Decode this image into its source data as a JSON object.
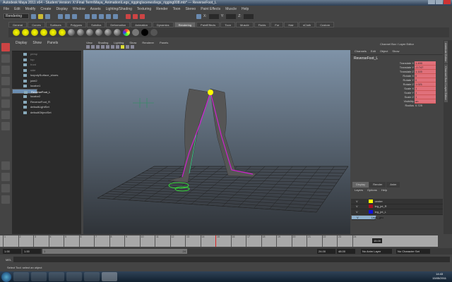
{
  "title": "Autodesk Maya 2011 x64 - Student Version: X:\\Final Term\\Maya_Animation\\Legs_rigging\\scenes\\legs_rigging008.mb* --- ReverseFoot_L",
  "menu": [
    "File",
    "Edit",
    "Modify",
    "Create",
    "Display",
    "Window",
    "Assets",
    "Lighting/Shading",
    "Texturing",
    "Render",
    "Toon",
    "Stereo",
    "Paint Effects",
    "Muscle",
    "Help"
  ],
  "menu_set": "Rendering",
  "coords": {
    "x": "X:",
    "y": "Y:",
    "z": "Z:"
  },
  "shelf_tabs": [
    "General",
    "Curves",
    "Surfaces",
    "Polygons",
    "Subdivs",
    "Deformation",
    "Animation",
    "Dynamics",
    "Rendering",
    "PaintEffects",
    "Toon",
    "Muscle",
    "Fluids",
    "Fur",
    "Hair",
    "nCloth",
    "Custom"
  ],
  "active_shelf": "Rendering",
  "outliner": {
    "menu": [
      "Display",
      "Show",
      "Panels"
    ],
    "items": [
      {
        "label": "persp",
        "dim": true
      },
      {
        "label": "top",
        "dim": true
      },
      {
        "label": "front",
        "dim": true
      },
      {
        "label": "side",
        "dim": true
      },
      {
        "label": "loopolySurface_shoes"
      },
      {
        "label": "joint2"
      },
      {
        "label": "locator1"
      },
      {
        "label": "ReverseFoot_L",
        "selected": true
      },
      {
        "label": "locator2"
      },
      {
        "label": "ReverseFoot_R"
      },
      {
        "label": "defaultLightSet"
      },
      {
        "label": "defaultObjectSet"
      }
    ]
  },
  "viewport": {
    "menu": [
      "View",
      "Shading",
      "Lighting",
      "Show",
      "Renderer",
      "Panels"
    ]
  },
  "channel_box": {
    "title": "Channel Box / Layer Editor",
    "menu": [
      "Channels",
      "Edit",
      "Object",
      "Show"
    ],
    "object": "ReverseFoot_L",
    "attributes": [
      {
        "name": "Translate X",
        "value": "1.490"
      },
      {
        "name": "Translate Y",
        "value": "-0.747"
      },
      {
        "name": "Translate Z",
        "value": "1.115"
      },
      {
        "name": "Rotate X",
        "value": "0"
      },
      {
        "name": "Rotate Y",
        "value": "0"
      },
      {
        "name": "Rotate Z",
        "value": "1.021"
      },
      {
        "name": "Scale X",
        "value": "1"
      },
      {
        "name": "Scale Y",
        "value": "1"
      },
      {
        "name": "Scale Z",
        "value": "1"
      },
      {
        "name": "Visibility",
        "value": "on"
      }
    ],
    "radius": {
      "name": "Radius",
      "value": "0.725"
    }
  },
  "side_tabs": [
    "Attribute Editor",
    "Channel Box / Layer Editor"
  ],
  "layer_editor": {
    "tabs": [
      "Display",
      "Render",
      "Anim"
    ],
    "menu": [
      "Layers",
      "Options",
      "Help"
    ],
    "layers": [
      {
        "v": "V",
        "name": "center",
        "color": "#ffff00"
      },
      {
        "v": "V",
        "name": "leg_jnt_R",
        "color": "#a01020"
      },
      {
        "v": "V",
        "name": "leg_jnt_L",
        "color": "#1010e0"
      },
      {
        "v": "V",
        "name": "Legs_geo",
        "color": "#222222",
        "selected": true
      }
    ]
  },
  "timeline": {
    "ticks": [
      "1",
      "2",
      "3",
      "4",
      "5",
      "6",
      "7",
      "8",
      "9",
      "10",
      "11",
      "12",
      "13",
      "14",
      "15",
      "16",
      "17",
      "18",
      "19",
      "20",
      "21",
      "22",
      "23",
      "24"
    ],
    "current_frame": "15.00"
  },
  "range": {
    "start": "1.00",
    "start2": "1.00",
    "inner_start": "1",
    "inner_end": "24",
    "end": "24.00",
    "end2": "48.00",
    "anim_layer": "No Anim Layer",
    "character": "No Character Set"
  },
  "mel_label": "MEL",
  "help_line": "Select Tool: select an object",
  "clock": {
    "time": "14:43",
    "date": "15/05/2011"
  }
}
